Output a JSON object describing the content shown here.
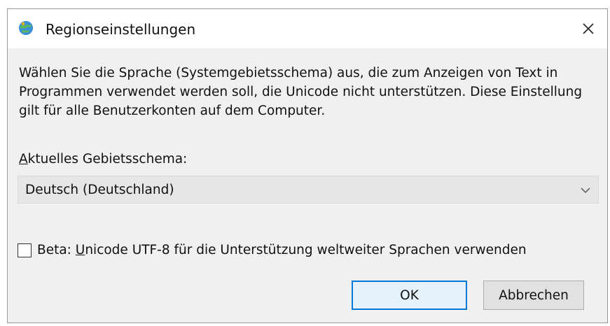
{
  "window": {
    "title": "Regionseinstellungen",
    "icon": "globe-settings-icon",
    "close_icon": "close-icon"
  },
  "description": "Wählen Sie die Sprache (Systemgebietsschema) aus, die zum Anzeigen von Text in Programmen verwendet werden soll, die Unicode nicht unterstützen. Diese Einstellung gilt für alle Benutzerkonten auf dem Computer.",
  "locale": {
    "label_mnemonic": "A",
    "label_rest": "ktuelles Gebietsschema:",
    "selected_value": "Deutsch (Deutschland)"
  },
  "beta_option": {
    "label_prefix": "Beta: ",
    "label_mnemonic": "U",
    "label_rest": "nicode UTF-8 für die Unterstützung weltweiter Sprachen verwenden",
    "checked": false
  },
  "buttons": {
    "ok_label": "OK",
    "cancel_label": "Abbrechen"
  },
  "colors": {
    "dialog_bg": "#f0f0f0",
    "titlebar_bg": "#ffffff",
    "accent": "#0078d7"
  }
}
